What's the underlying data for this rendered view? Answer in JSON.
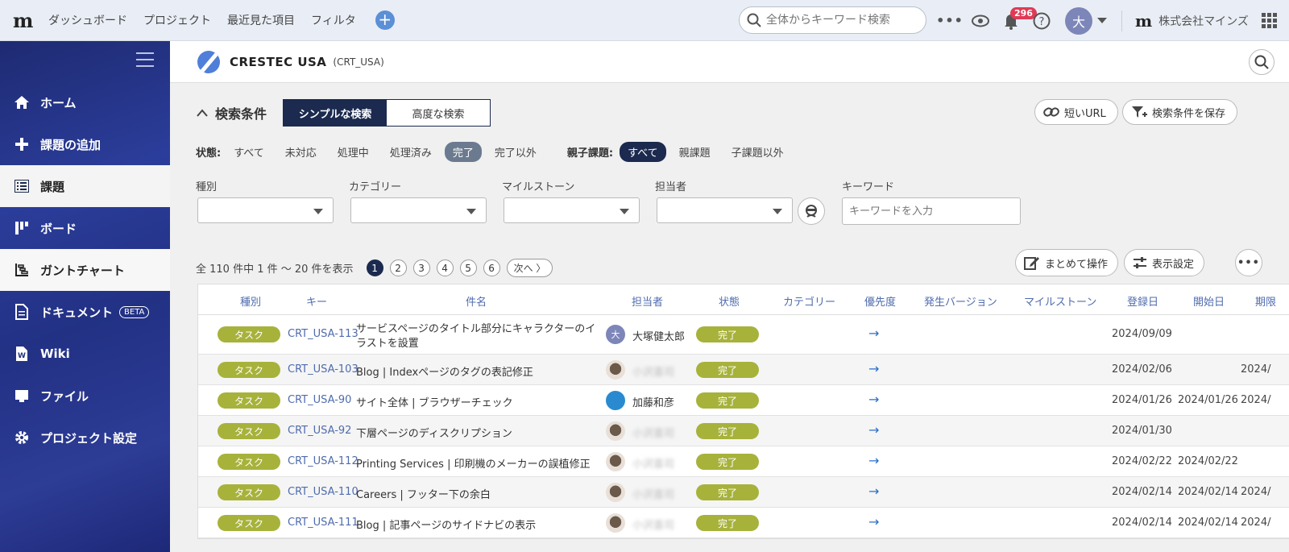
{
  "topbar": {
    "logo": "m",
    "nav": [
      "ダッシュボード",
      "プロジェクト",
      "最近見た項目",
      "フィルタ"
    ],
    "search_placeholder": "全体からキーワード検索",
    "notification_count": "296",
    "user_initial": "大",
    "company_logo": "m",
    "company": "株式会社マインズ"
  },
  "sidebar": {
    "items": [
      {
        "label": "ホーム",
        "icon": "home-icon"
      },
      {
        "label": "課題の追加",
        "icon": "plus-icon"
      },
      {
        "label": "課題",
        "icon": "list-icon"
      },
      {
        "label": "ボード",
        "icon": "board-icon"
      },
      {
        "label": "ガントチャート",
        "icon": "gantt-icon"
      },
      {
        "label": "ドキュメント",
        "icon": "document-icon",
        "badge": "BETA"
      },
      {
        "label": "Wiki",
        "icon": "wiki-icon"
      },
      {
        "label": "ファイル",
        "icon": "file-icon"
      },
      {
        "label": "プロジェクト設定",
        "icon": "gear-icon"
      }
    ]
  },
  "project": {
    "name": "CRESTEC USA",
    "key": "(CRT_USA)"
  },
  "search": {
    "title": "検索条件",
    "simple": "シンプルな検索",
    "advanced": "高度な検索",
    "short_url": "短いURL",
    "save": "検索条件を保存"
  },
  "filters": {
    "status_label": "状態:",
    "status_options": [
      "すべて",
      "未対応",
      "処理中",
      "処理済み",
      "完了",
      "完了以外"
    ],
    "parent_label": "親子課題:",
    "parent_options": [
      "すべて",
      "親課題",
      "子課題以外"
    ]
  },
  "fields": {
    "type": "種別",
    "category": "カテゴリー",
    "milestone": "マイルストーン",
    "assignee": "担当者",
    "keyword": "キーワード",
    "keyword_placeholder": "キーワードを入力"
  },
  "list": {
    "count_text": "全 110 件中 1 件 ～ 20 件を表示",
    "pages": [
      "1",
      "2",
      "3",
      "4",
      "5",
      "6"
    ],
    "next": "次へ",
    "bulk": "まとめて操作",
    "display": "表示設定"
  },
  "table": {
    "headers": [
      "種別",
      "キー",
      "件名",
      "担当者",
      "状態",
      "カテゴリー",
      "優先度",
      "発生バージョン",
      "マイルストーン",
      "登録日",
      "開始日",
      "期限"
    ],
    "rows": [
      {
        "type": "タスク",
        "key": "CRT_USA-113",
        "subject1": "サービスページのタイトル部分にキャラクターのイ",
        "subject2": "ラストを設置",
        "assignee": "大塚健太郎",
        "avatar": "letter",
        "avatar_text": "大",
        "status": "完了",
        "priority": "→",
        "created": "2024/09/09",
        "start": "",
        "due": ""
      },
      {
        "type": "タスク",
        "key": "CRT_USA-103",
        "subject1": "Blog | Indexページのタグの表記修正",
        "subject2": "",
        "assignee": "小沢喜司",
        "avatar": "photo",
        "avatar_text": "",
        "status": "完了",
        "priority": "→",
        "created": "2024/02/06",
        "start": "",
        "due": "2024/"
      },
      {
        "type": "タスク",
        "key": "CRT_USA-90",
        "subject1": "サイト全体 | ブラウザーチェック",
        "subject2": "",
        "assignee": "加藤和彦",
        "avatar": "glasses",
        "avatar_text": "",
        "status": "完了",
        "priority": "→",
        "created": "2024/01/26",
        "start": "2024/01/26",
        "due": "2024/"
      },
      {
        "type": "タスク",
        "key": "CRT_USA-92",
        "subject1": "下層ページのディスクリプション",
        "subject2": "",
        "assignee": "小沢喜司",
        "avatar": "photo",
        "avatar_text": "",
        "status": "完了",
        "priority": "→",
        "created": "2024/01/30",
        "start": "",
        "due": ""
      },
      {
        "type": "タスク",
        "key": "CRT_USA-112",
        "subject1": "Printing Services | 印刷機のメーカーの誤植修正",
        "subject2": "",
        "assignee": "小沢喜司",
        "avatar": "photo",
        "avatar_text": "",
        "status": "完了",
        "priority": "→",
        "created": "2024/02/22",
        "start": "2024/02/22",
        "due": ""
      },
      {
        "type": "タスク",
        "key": "CRT_USA-110",
        "subject1": "Careers | フッター下の余白",
        "subject2": "",
        "assignee": "小沢喜司",
        "avatar": "photo",
        "avatar_text": "",
        "status": "完了",
        "priority": "→",
        "created": "2024/02/14",
        "start": "2024/02/14",
        "due": "2024/"
      },
      {
        "type": "タスク",
        "key": "CRT_USA-111",
        "subject1": "Blog | 記事ページのサイドナビの表示",
        "subject2": "",
        "assignee": "小沢喜司",
        "avatar": "photo",
        "avatar_text": "",
        "status": "完了",
        "priority": "→",
        "created": "2024/02/14",
        "start": "2024/02/14",
        "due": "2024/"
      }
    ]
  }
}
